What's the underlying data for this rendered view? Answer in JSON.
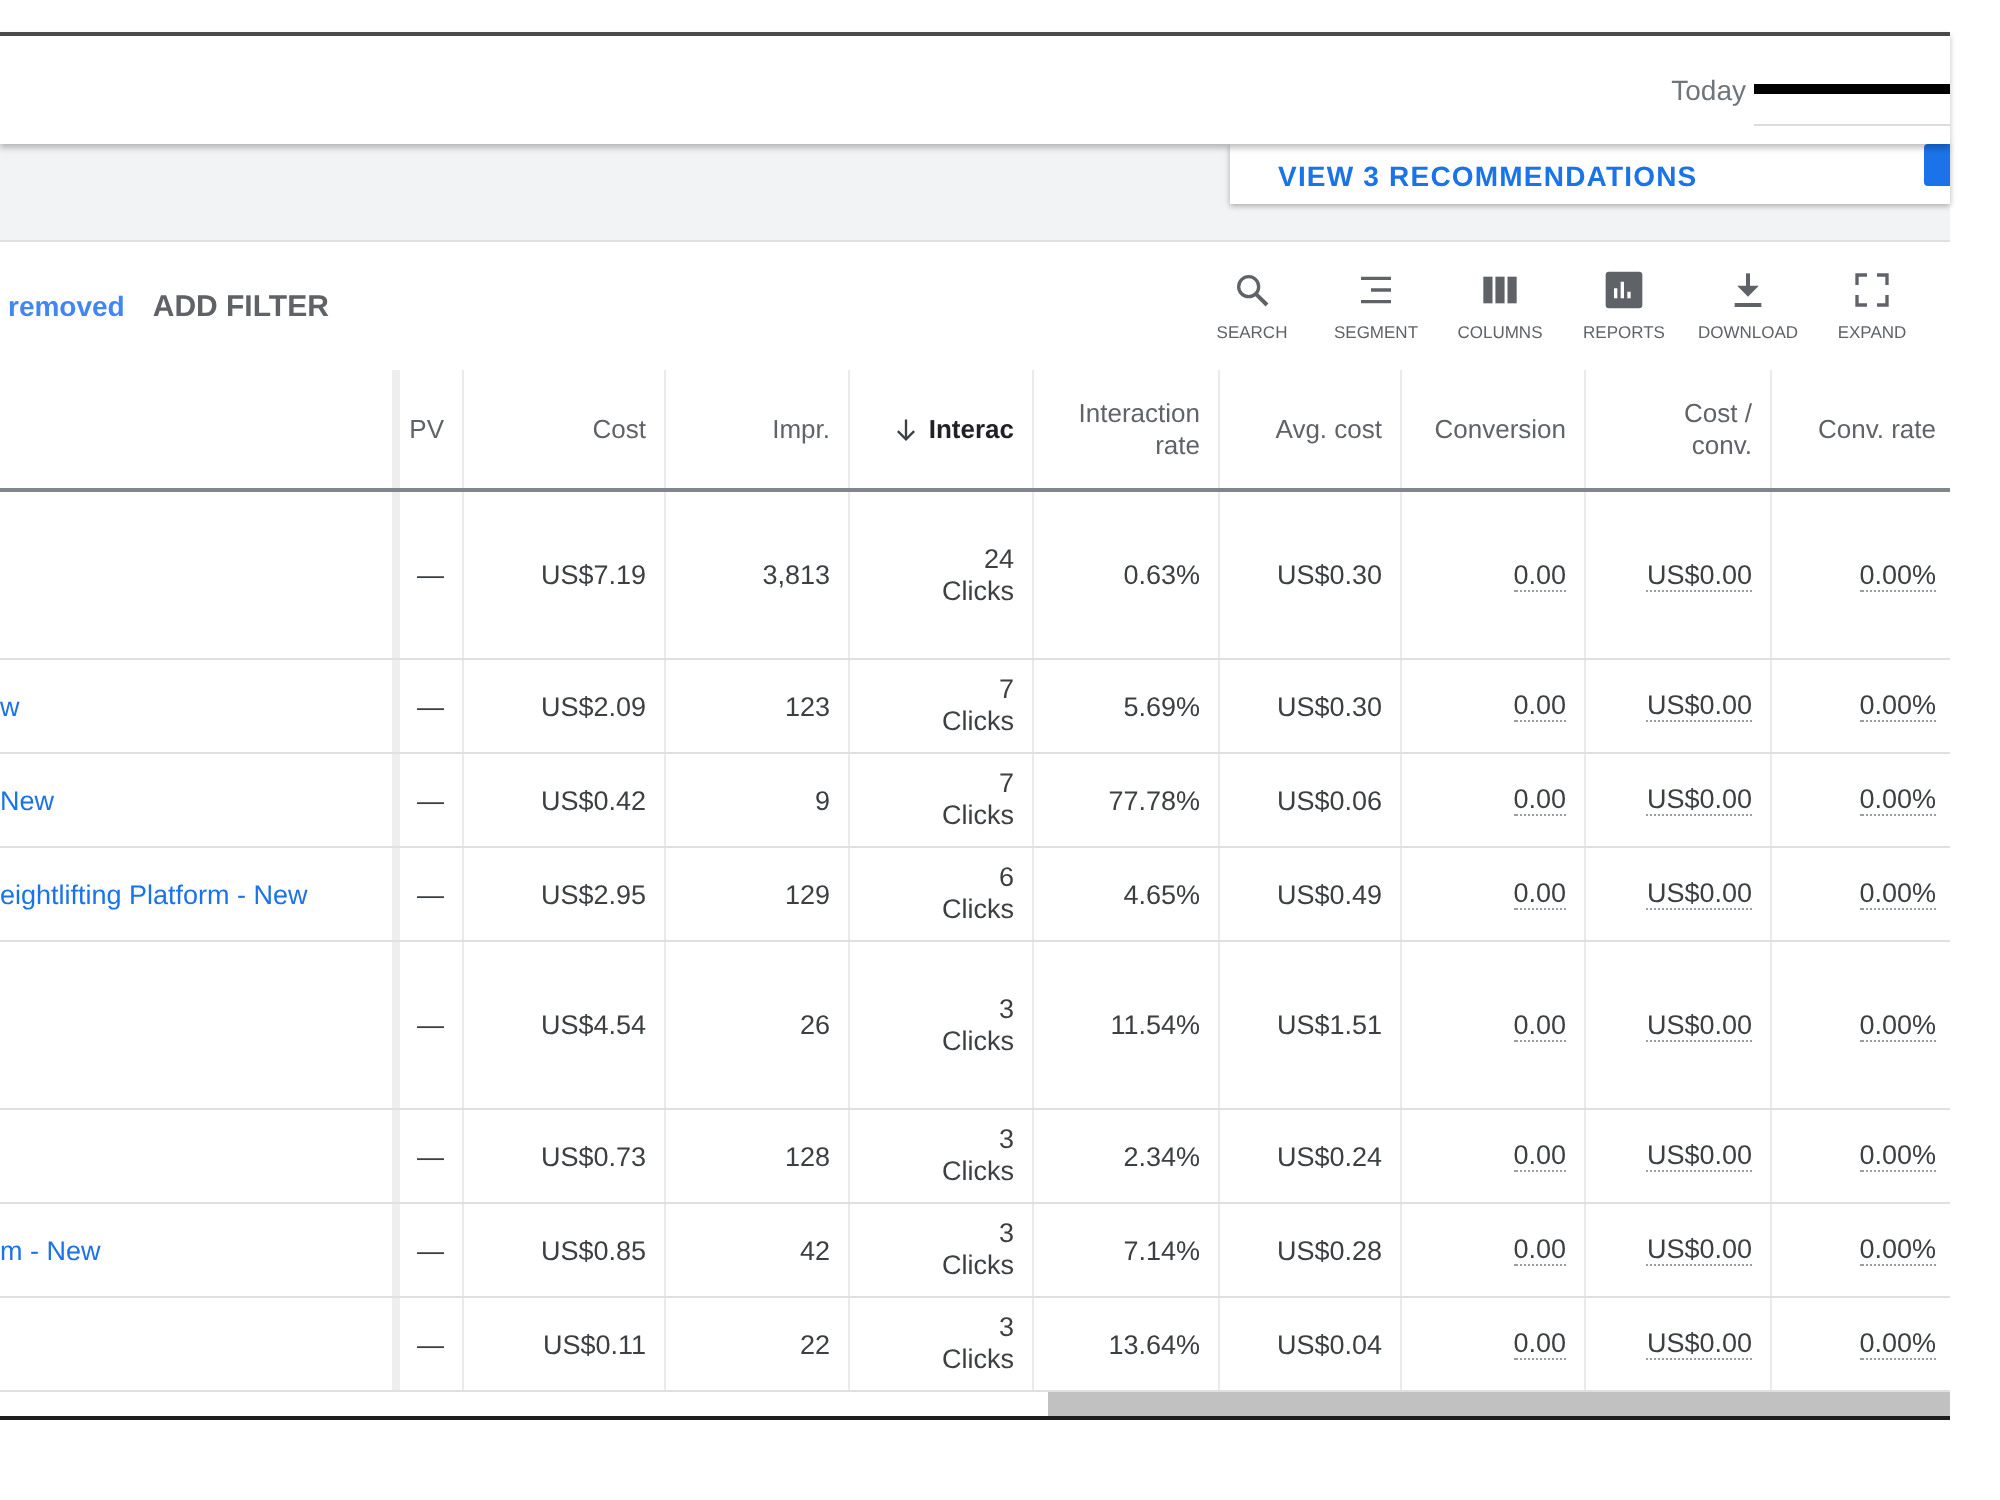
{
  "top_bar": {
    "date_label": "Today",
    "date_redacted": true
  },
  "recommendations": {
    "link": "VIEW 3 RECOMMENDATIONS"
  },
  "toolbar": {
    "filter_status": "removed",
    "add_filter": "ADD FILTER",
    "tools": [
      {
        "kind": "search",
        "label": "SEARCH"
      },
      {
        "kind": "segment",
        "label": "SEGMENT"
      },
      {
        "kind": "columns",
        "label": "COLUMNS"
      },
      {
        "kind": "reports",
        "label": "REPORTS"
      },
      {
        "kind": "download",
        "label": "DOWNLOAD"
      },
      {
        "kind": "expand",
        "label": "EXPAND"
      }
    ]
  },
  "table": {
    "columns": [
      {
        "label": "PV",
        "kind": "plain",
        "sorted": false
      },
      {
        "label": "Cost",
        "kind": "plain",
        "sorted": false
      },
      {
        "label": "Impr.",
        "kind": "plain",
        "sorted": false
      },
      {
        "label": "Interac",
        "kind": "count",
        "sorted": true
      },
      {
        "label": "Interaction rate",
        "kind": "plain",
        "sorted": false
      },
      {
        "label": "Avg. cost",
        "kind": "plain",
        "sorted": false
      },
      {
        "label": "Conversion",
        "kind": "dotted",
        "sorted": false
      },
      {
        "label": "Cost / conv.",
        "kind": "dotted",
        "sorted": false
      },
      {
        "label": "Conv. rate",
        "kind": "dotted",
        "sorted": false
      }
    ],
    "rows": [
      {
        "tall": true,
        "cells": [
          "—",
          "US$7.19",
          "3,813",
          {
            "count": "24",
            "unit": "Clicks"
          },
          "0.63%",
          "US$0.30",
          "0.00",
          "US$0.00",
          "0.00%"
        ]
      },
      {
        "name": "w",
        "tall": false,
        "cells": [
          "—",
          "US$2.09",
          "123",
          {
            "count": "7",
            "unit": "Clicks"
          },
          "5.69%",
          "US$0.30",
          "0.00",
          "US$0.00",
          "0.00%"
        ]
      },
      {
        "name": "New",
        "tall": false,
        "cells": [
          "—",
          "US$0.42",
          "9",
          {
            "count": "7",
            "unit": "Clicks"
          },
          "77.78%",
          "US$0.06",
          "0.00",
          "US$0.00",
          "0.00%"
        ]
      },
      {
        "name": "eightlifting Platform - New",
        "tall": false,
        "cells": [
          "—",
          "US$2.95",
          "129",
          {
            "count": "6",
            "unit": "Clicks"
          },
          "4.65%",
          "US$0.49",
          "0.00",
          "US$0.00",
          "0.00%"
        ]
      },
      {
        "tall": true,
        "cells": [
          "—",
          "US$4.54",
          "26",
          {
            "count": "3",
            "unit": "Clicks"
          },
          "11.54%",
          "US$1.51",
          "0.00",
          "US$0.00",
          "0.00%"
        ]
      },
      {
        "tall": false,
        "cells": [
          "—",
          "US$0.73",
          "128",
          {
            "count": "3",
            "unit": "Clicks"
          },
          "2.34%",
          "US$0.24",
          "0.00",
          "US$0.00",
          "0.00%"
        ]
      },
      {
        "name": "m - New",
        "tall": false,
        "cells": [
          "—",
          "US$0.85",
          "42",
          {
            "count": "3",
            "unit": "Clicks"
          },
          "7.14%",
          "US$0.28",
          "0.00",
          "US$0.00",
          "0.00%"
        ]
      },
      {
        "tall": false,
        "cells": [
          "—",
          "US$0.11",
          "22",
          {
            "count": "3",
            "unit": "Clicks"
          },
          "13.64%",
          "US$0.04",
          "0.00",
          "US$0.00",
          "0.00%"
        ]
      }
    ]
  }
}
